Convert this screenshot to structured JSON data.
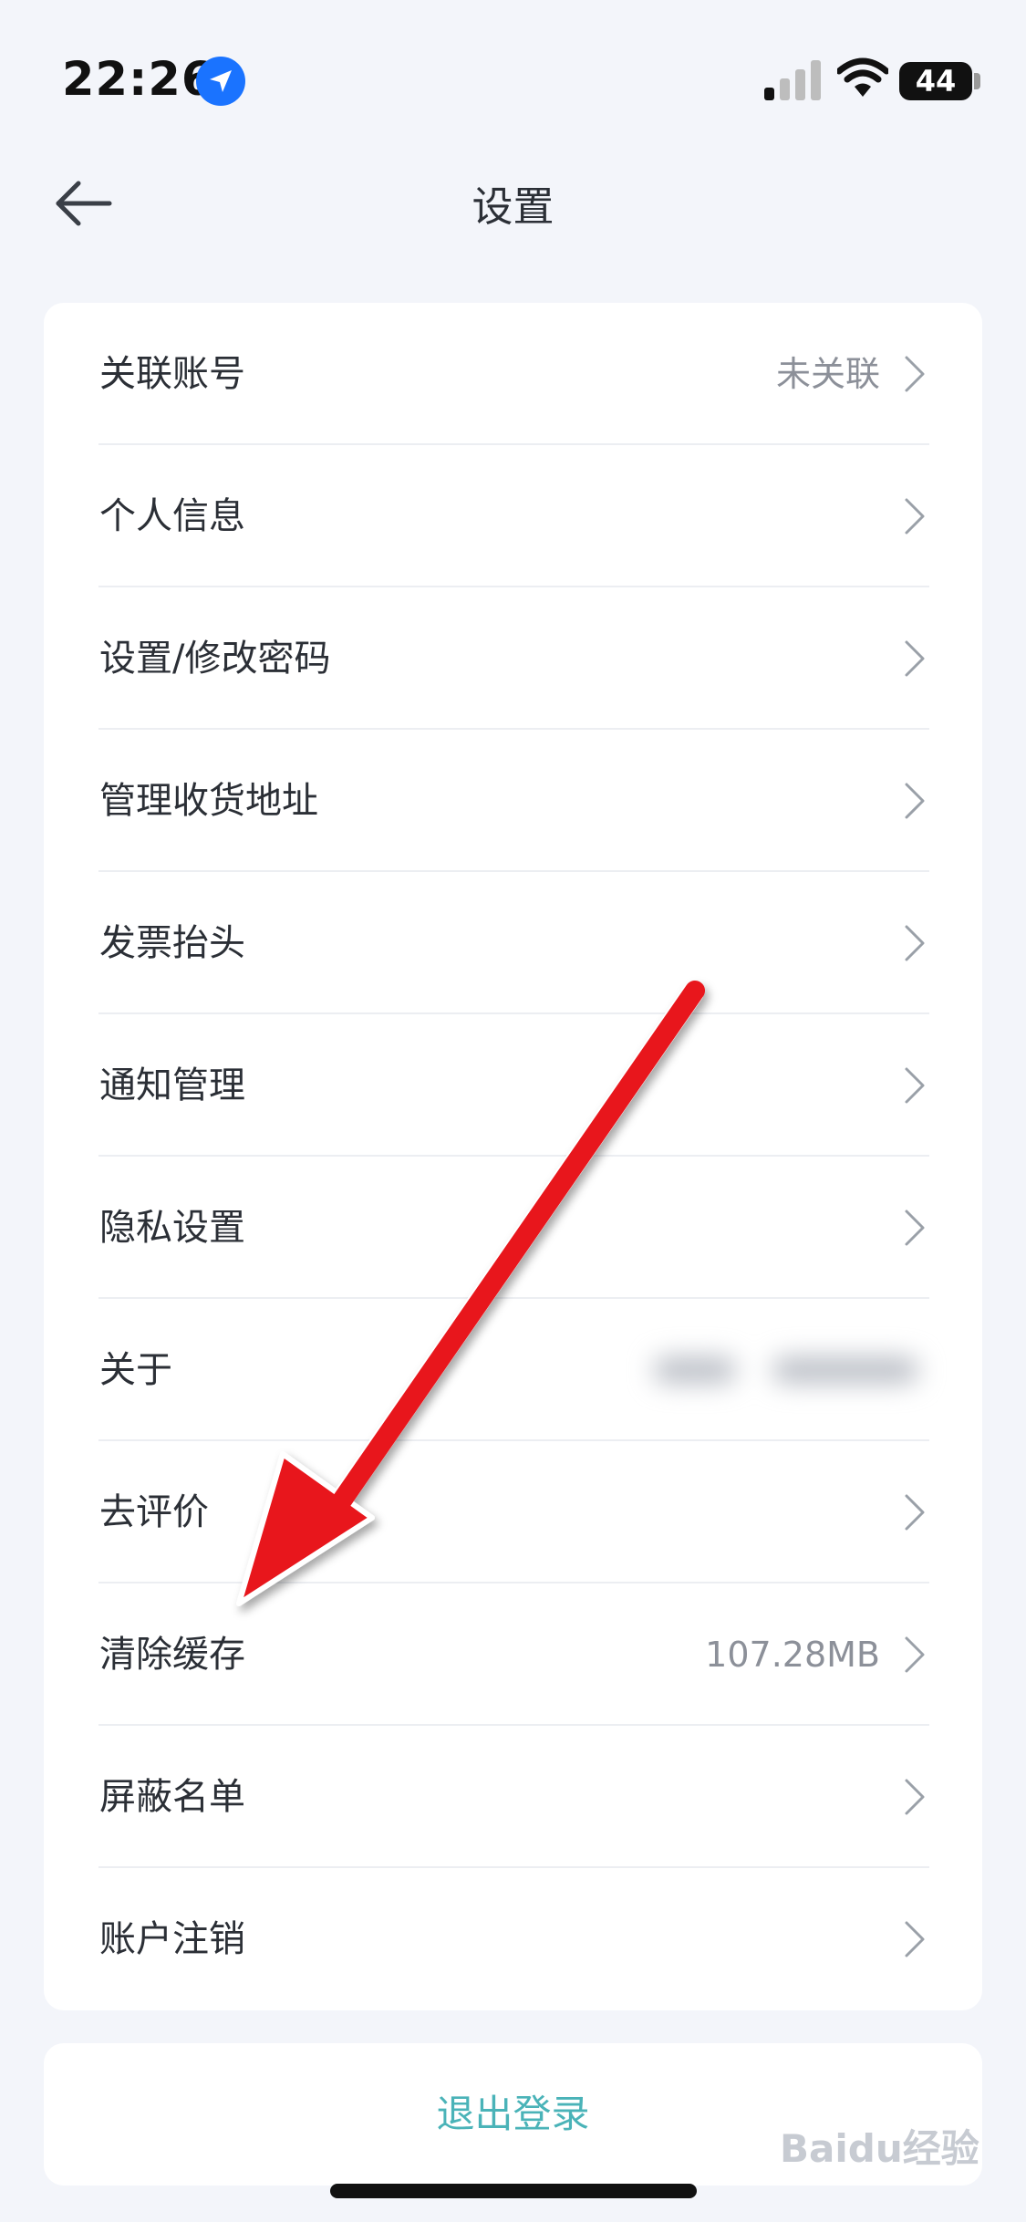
{
  "status_bar": {
    "time": "22:26",
    "battery": "44",
    "icons": [
      "location-icon",
      "signal-icon",
      "wifi-icon",
      "battery-icon"
    ]
  },
  "nav": {
    "title": "设置",
    "back_icon": "arrow-left-icon"
  },
  "settings": {
    "items": [
      {
        "label": "关联账号",
        "value": "未关联"
      },
      {
        "label": "个人信息",
        "value": ""
      },
      {
        "label": "设置/修改密码",
        "value": ""
      },
      {
        "label": "管理收货地址",
        "value": ""
      },
      {
        "label": "发票抬头",
        "value": ""
      },
      {
        "label": "通知管理",
        "value": ""
      },
      {
        "label": "隐私设置",
        "value": ""
      },
      {
        "label": "关于",
        "value": ""
      },
      {
        "label": "去评价",
        "value": ""
      },
      {
        "label": "清除缓存",
        "value": "107.28MB"
      },
      {
        "label": "屏蔽名单",
        "value": ""
      },
      {
        "label": "账户注销",
        "value": ""
      }
    ]
  },
  "logout": {
    "label": "退出登录"
  },
  "watermark": {
    "text": "Baidu经验"
  },
  "colors": {
    "background": "#f3f5fa",
    "card": "#ffffff",
    "text": "#2b2f36",
    "secondary_text": "#8c9099",
    "logout": "#4ab3b8",
    "annotation_arrow": "#e8141c"
  }
}
